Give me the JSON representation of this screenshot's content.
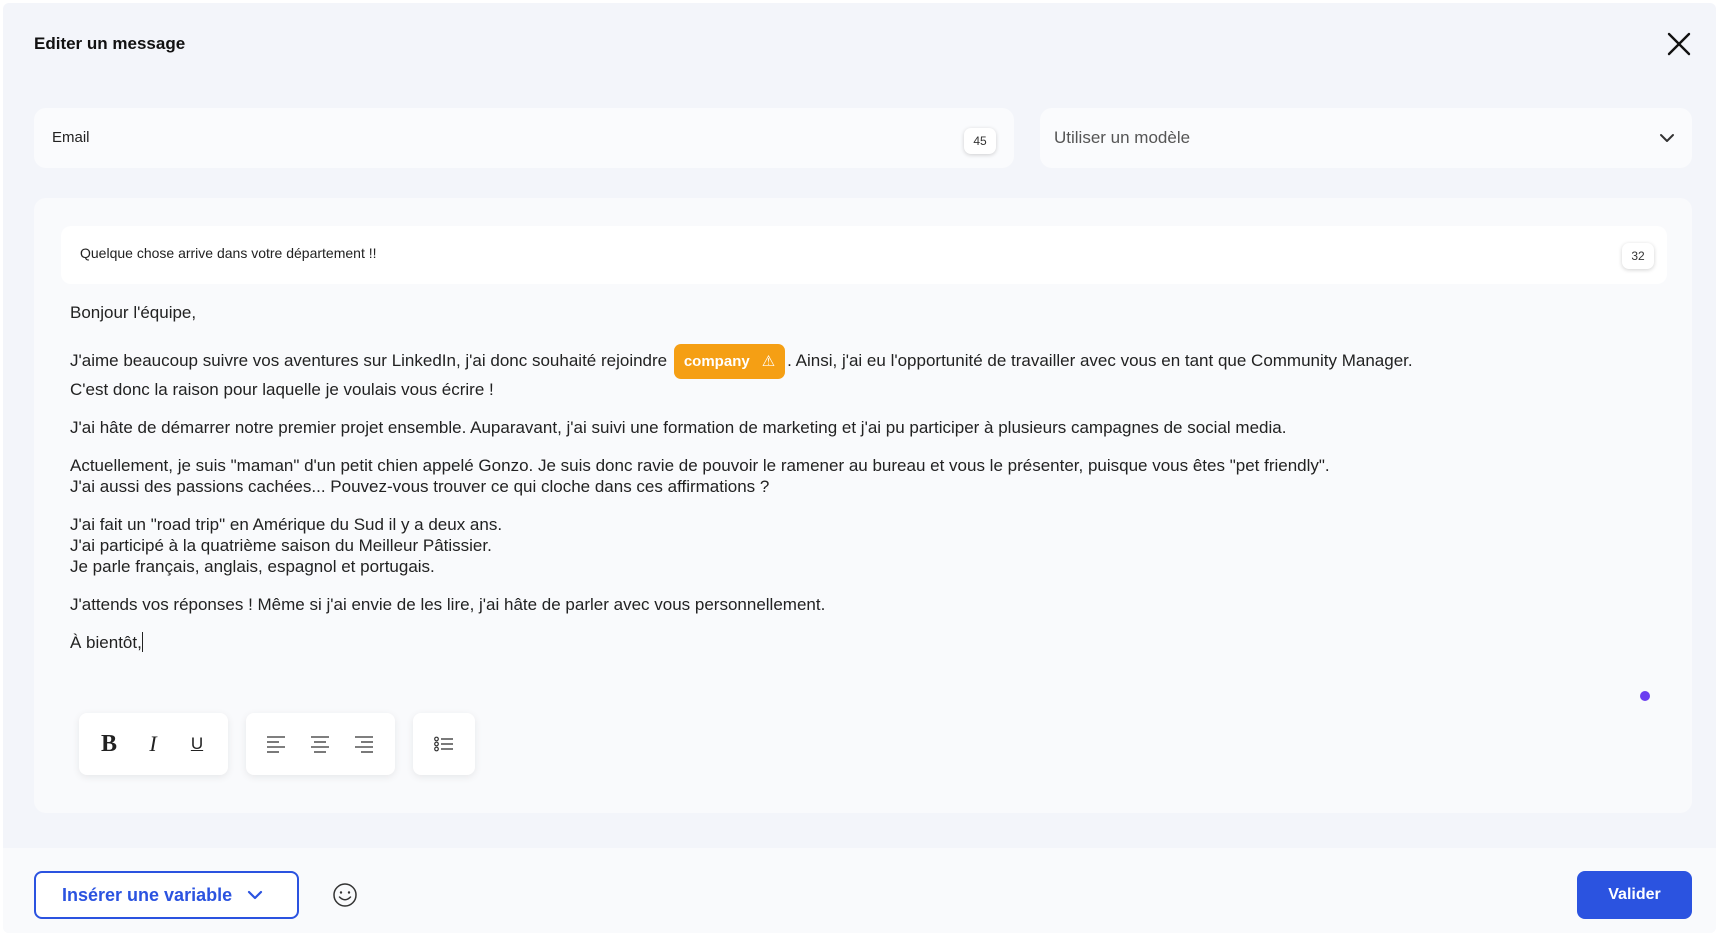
{
  "modal": {
    "title": "Editer un message"
  },
  "email_field": {
    "value": "Email",
    "counter": "45"
  },
  "template_select": {
    "placeholder": "Utiliser un modèle"
  },
  "subject": {
    "value": "Quelque chose arrive dans votre département !!",
    "counter": "32"
  },
  "body": {
    "greeting": "Bonjour l'équipe,",
    "p1_before_chip": "J'aime beaucoup suivre vos aventures sur LinkedIn, j'ai donc souhaité rejoindre ",
    "p1_chip": "company",
    "p1_after_chip": ". Ainsi, j'ai eu l'opportunité de travailler avec vous en tant que Community Manager.",
    "p1_line2": "C'est donc la raison pour laquelle je voulais vous écrire !",
    "p2": "J'ai hâte de démarrer notre premier projet ensemble. Auparavant, j'ai suivi une formation de marketing et j'ai pu participer à plusieurs campagnes de social media.",
    "p3_line1": "Actuellement, je suis \"maman\" d'un petit chien appelé Gonzo. Je suis donc ravie de pouvoir le ramener au bureau et vous le présenter, puisque vous êtes \"pet friendly\".",
    "p3_line2": "J'ai aussi des passions cachées... Pouvez-vous trouver ce qui cloche dans ces affirmations ?",
    "p4_line1": "J'ai fait un \"road trip\" en Amérique du Sud il y a deux ans.",
    "p4_line2": "J'ai participé à la quatrième saison du Meilleur Pâtissier.",
    "p4_line3": "Je parle français, anglais, espagnol et portugais.",
    "p5": "J'attends vos réponses ! Même si j'ai envie de les lire, j'ai hâte de parler avec vous personnellement.",
    "closing": "À bientôt,"
  },
  "toolbar": {
    "bold": "B",
    "italic": "I",
    "underline": "U",
    "icons": [
      "align-left-icon",
      "align-center-icon",
      "align-right-icon",
      "bullet-list-icon"
    ]
  },
  "footer": {
    "insert_variable_label": "Insérer une variable",
    "validate_label": "Valider"
  },
  "colors": {
    "accent": "#2b53e0",
    "chip": "#f59f14",
    "dot": "#6a3df0",
    "background": "#f3f5fa"
  }
}
